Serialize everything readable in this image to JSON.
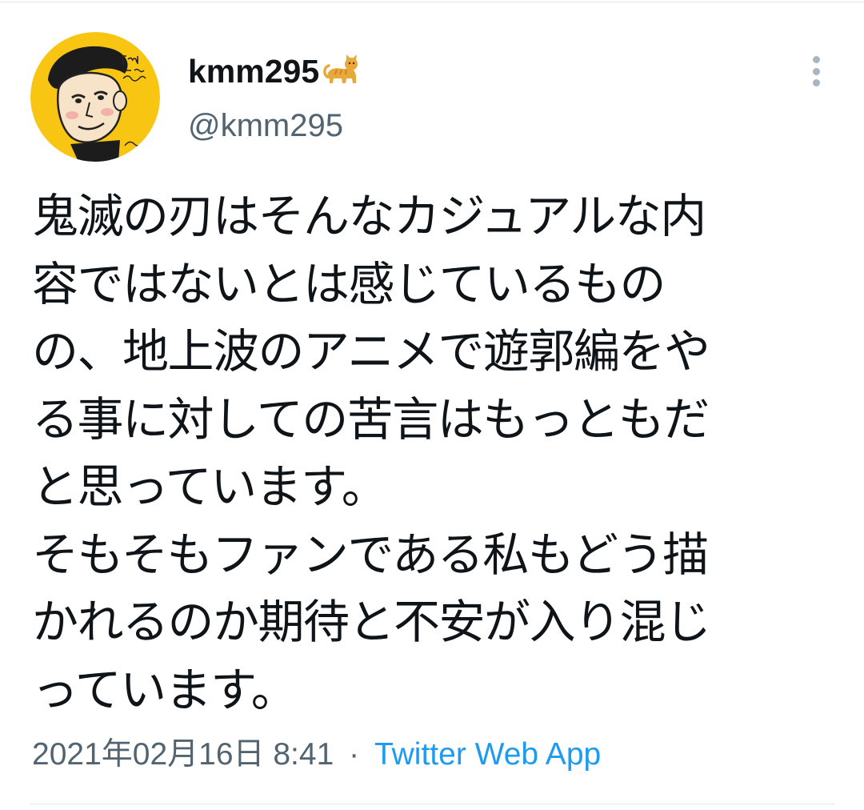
{
  "author": {
    "display_name": "kmm295",
    "emoji_icon": "cat-icon",
    "handle": "@kmm295"
  },
  "tweet": {
    "lines": [
      "鬼滅の刃はそんなカジュアルな内",
      "容ではないとは感じているもの",
      "の、地上波のアニメで遊郭編をや",
      "る事に対しての苦言はもっともだ",
      "と思っています。",
      "そもそもファンである私もどう描",
      "かれるのか期待と不安が入り混じ",
      "っています。"
    ]
  },
  "meta": {
    "timestamp": "2021年02月16日 8:41",
    "separator": "·",
    "source": "Twitter Web App"
  },
  "colors": {
    "text": "#0f1419",
    "secondary": "#536471",
    "link": "#1d9bf0",
    "avatar_bg": "#f9c513"
  }
}
